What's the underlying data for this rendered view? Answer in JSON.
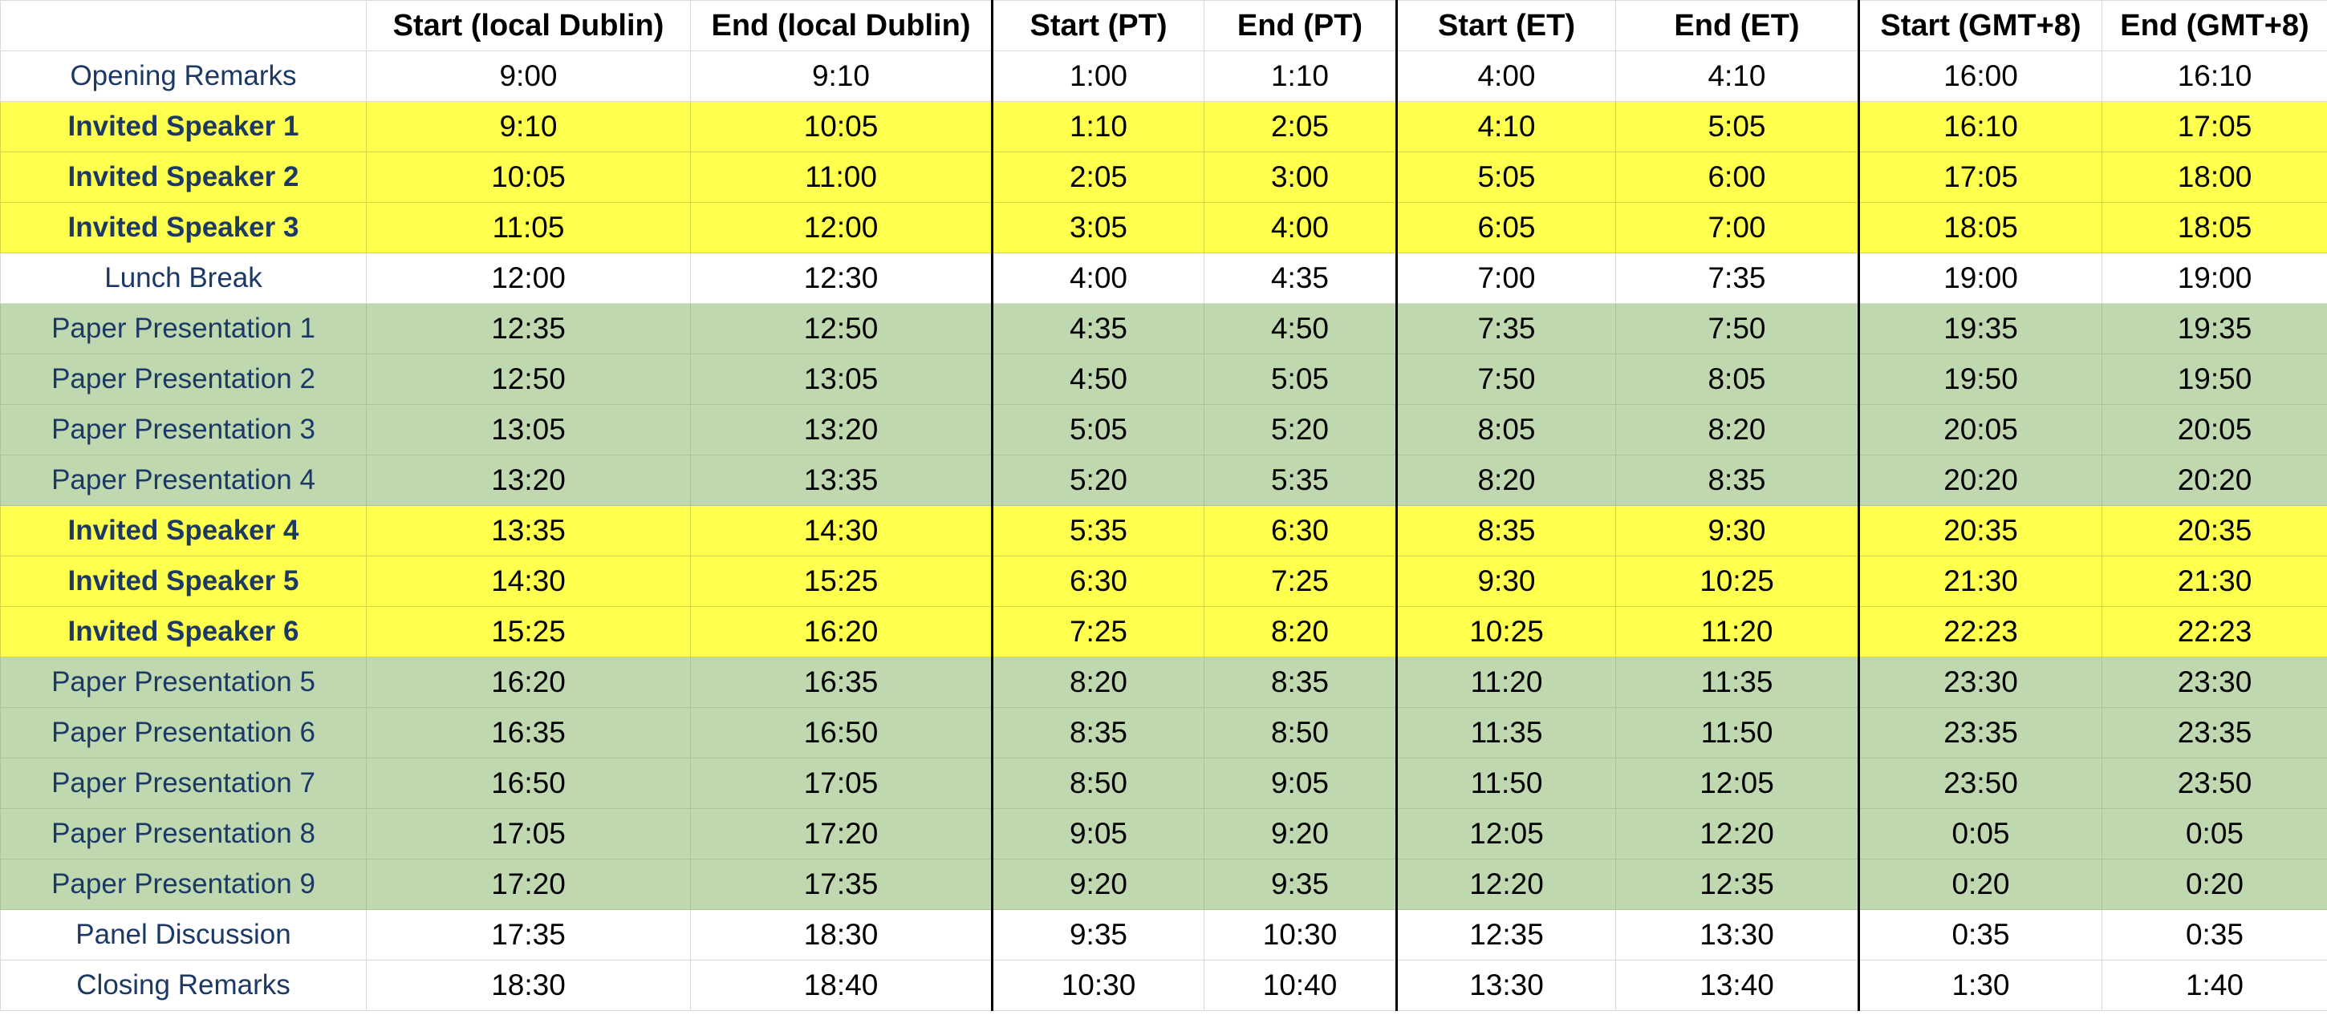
{
  "header": {
    "corner": "",
    "columns": [
      "Start (local Dublin)",
      "End (local Dublin)",
      "Start (PT)",
      "End (PT)",
      "Start (ET)",
      "End (ET)",
      "Start (GMT+8)",
      "End (GMT+8)"
    ]
  },
  "colors": {
    "speaker_row": "#ffff4d",
    "paper_row": "#bfd8b0",
    "label_text": "#1c3966"
  },
  "rows": [
    {
      "type": "plain",
      "label": "Opening Remarks",
      "times": [
        "9:00",
        "9:10",
        "1:00",
        "1:10",
        "4:00",
        "4:10",
        "16:00",
        "16:10"
      ]
    },
    {
      "type": "speaker",
      "label": "Invited Speaker 1",
      "times": [
        "9:10",
        "10:05",
        "1:10",
        "2:05",
        "4:10",
        "5:05",
        "16:10",
        "17:05"
      ]
    },
    {
      "type": "speaker",
      "label": "Invited Speaker 2",
      "times": [
        "10:05",
        "11:00",
        "2:05",
        "3:00",
        "5:05",
        "6:00",
        "17:05",
        "18:00"
      ]
    },
    {
      "type": "speaker",
      "label": "Invited Speaker 3",
      "times": [
        "11:05",
        "12:00",
        "3:05",
        "4:00",
        "6:05",
        "7:00",
        "18:05",
        "18:05"
      ]
    },
    {
      "type": "plain",
      "label": "Lunch Break",
      "times": [
        "12:00",
        "12:30",
        "4:00",
        "4:35",
        "7:00",
        "7:35",
        "19:00",
        "19:00"
      ]
    },
    {
      "type": "paper",
      "label": "Paper Presentation 1",
      "times": [
        "12:35",
        "12:50",
        "4:35",
        "4:50",
        "7:35",
        "7:50",
        "19:35",
        "19:35"
      ]
    },
    {
      "type": "paper",
      "label": "Paper Presentation 2",
      "times": [
        "12:50",
        "13:05",
        "4:50",
        "5:05",
        "7:50",
        "8:05",
        "19:50",
        "19:50"
      ]
    },
    {
      "type": "paper",
      "label": "Paper Presentation 3",
      "times": [
        "13:05",
        "13:20",
        "5:05",
        "5:20",
        "8:05",
        "8:20",
        "20:05",
        "20:05"
      ]
    },
    {
      "type": "paper",
      "label": "Paper Presentation 4",
      "times": [
        "13:20",
        "13:35",
        "5:20",
        "5:35",
        "8:20",
        "8:35",
        "20:20",
        "20:20"
      ]
    },
    {
      "type": "speaker",
      "label": "Invited Speaker 4",
      "times": [
        "13:35",
        "14:30",
        "5:35",
        "6:30",
        "8:35",
        "9:30",
        "20:35",
        "20:35"
      ]
    },
    {
      "type": "speaker",
      "label": "Invited Speaker 5",
      "times": [
        "14:30",
        "15:25",
        "6:30",
        "7:25",
        "9:30",
        "10:25",
        "21:30",
        "21:30"
      ]
    },
    {
      "type": "speaker",
      "label": "Invited Speaker 6",
      "times": [
        "15:25",
        "16:20",
        "7:25",
        "8:20",
        "10:25",
        "11:20",
        "22:23",
        "22:23"
      ]
    },
    {
      "type": "paper",
      "label": "Paper Presentation 5",
      "times": [
        "16:20",
        "16:35",
        "8:20",
        "8:35",
        "11:20",
        "11:35",
        "23:30",
        "23:30"
      ]
    },
    {
      "type": "paper",
      "label": "Paper Presentation 6",
      "times": [
        "16:35",
        "16:50",
        "8:35",
        "8:50",
        "11:35",
        "11:50",
        "23:35",
        "23:35"
      ]
    },
    {
      "type": "paper",
      "label": "Paper Presentation 7",
      "times": [
        "16:50",
        "17:05",
        "8:50",
        "9:05",
        "11:50",
        "12:05",
        "23:50",
        "23:50"
      ]
    },
    {
      "type": "paper",
      "label": "Paper Presentation 8",
      "times": [
        "17:05",
        "17:20",
        "9:05",
        "9:20",
        "12:05",
        "12:20",
        "0:05",
        "0:05"
      ]
    },
    {
      "type": "paper",
      "label": "Paper Presentation 9",
      "times": [
        "17:20",
        "17:35",
        "9:20",
        "9:35",
        "12:20",
        "12:35",
        "0:20",
        "0:20"
      ]
    },
    {
      "type": "plain",
      "label": "Panel Discussion",
      "times": [
        "17:35",
        "18:30",
        "9:35",
        "10:30",
        "12:35",
        "13:30",
        "0:35",
        "0:35"
      ]
    },
    {
      "type": "plain",
      "label": "Closing Remarks",
      "times": [
        "18:30",
        "18:40",
        "10:30",
        "10:40",
        "13:30",
        "13:40",
        "1:30",
        "1:40"
      ]
    }
  ]
}
